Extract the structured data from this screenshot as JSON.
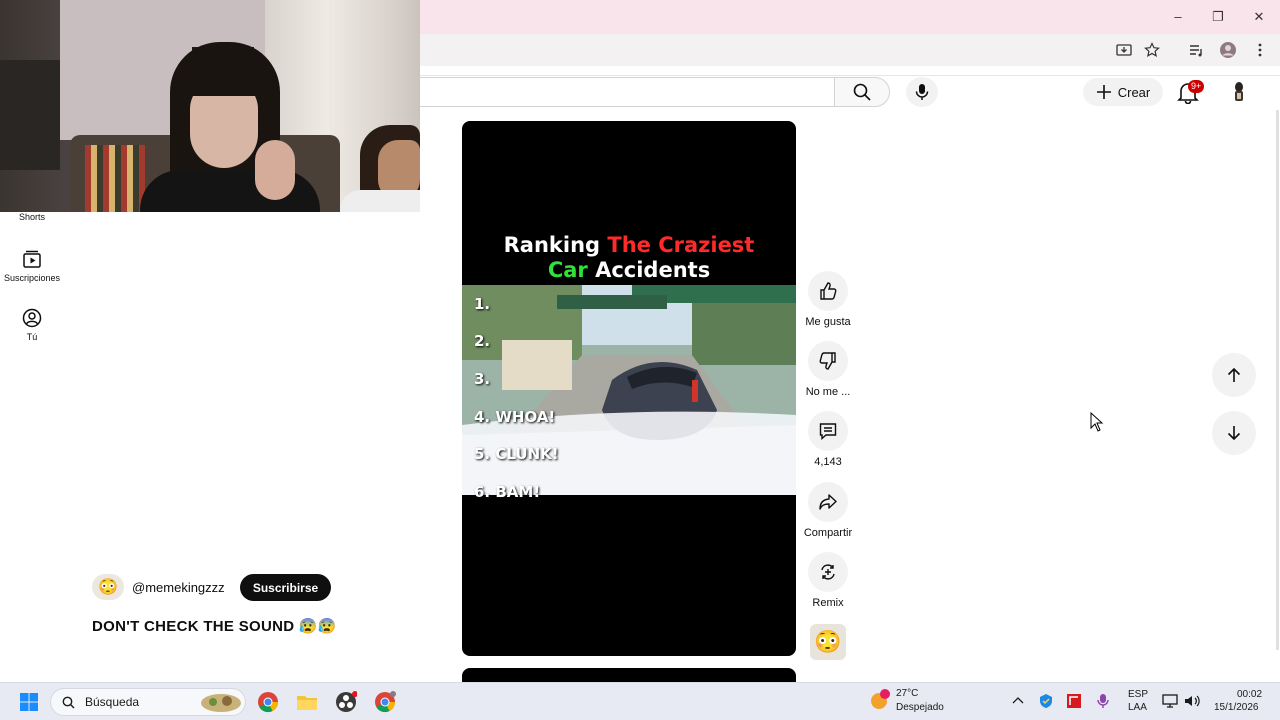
{
  "browser": {
    "window_controls": {
      "minimize": "–",
      "restore": "❐",
      "close": "✕"
    }
  },
  "header": {
    "create_label": "Crear",
    "notification_badge": "9+"
  },
  "sidebar": {
    "items": [
      {
        "label": "Shorts",
        "icon": "shorts-icon"
      },
      {
        "label": "Suscripciones",
        "icon": "subscriptions-icon"
      },
      {
        "label": "Tú",
        "icon": "you-icon"
      }
    ]
  },
  "video": {
    "title_part1": "Ranking ",
    "title_part2": "The Craziest",
    "title_part3": "Car",
    "title_part4": " Accidents",
    "ranks": [
      "1.",
      "2.",
      "3.",
      "4. WHOA!",
      "5. CLUNK!",
      "6. BAM!"
    ],
    "colors": {
      "highlight_red": "#ff2a2a",
      "highlight_green": "#31e03a"
    }
  },
  "actions": {
    "like_label": "Me gusta",
    "dislike_label": "No me ...",
    "comments_count": "4,143",
    "share_label": "Compartir",
    "remix_label": "Remix"
  },
  "channel": {
    "handle": "@memekingzzz",
    "subscribe_label": "Suscribirse",
    "caption": "DON'T CHECK THE SOUND 😰😰"
  },
  "taskbar": {
    "search_label": "Búsqueda",
    "weather_temp": "27°C",
    "weather_desc": "Despejado",
    "lang_top": "ESP",
    "lang_bottom": "LAA",
    "time": "00:02",
    "date": "15/1/2026"
  }
}
